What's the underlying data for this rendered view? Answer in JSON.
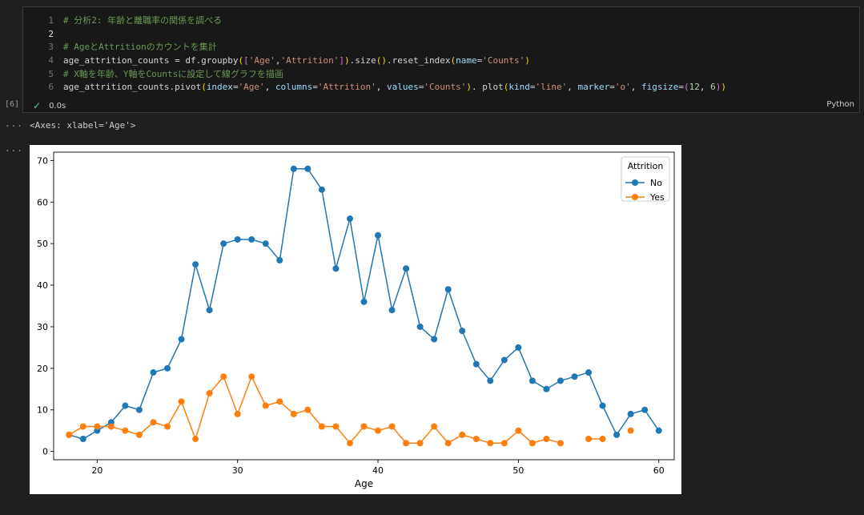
{
  "cell": {
    "execution_count": "[6]",
    "lines": [
      {
        "n": "1",
        "tokens": [
          {
            "t": "# 分析2: 年齢と離職率の関係を調べる",
            "c": "comment"
          }
        ]
      },
      {
        "n": "2",
        "tokens": []
      },
      {
        "n": "3",
        "tokens": [
          {
            "t": "# AgeとAttritionのカウントを集計",
            "c": "comment"
          }
        ]
      },
      {
        "n": "4",
        "tokens": [
          {
            "t": "age_attrition_counts = df.groupby",
            "c": ""
          },
          {
            "t": "(",
            "c": "paren1"
          },
          {
            "t": "[",
            "c": "paren2"
          },
          {
            "t": "'Age'",
            "c": "str"
          },
          {
            "t": ",",
            "c": ""
          },
          {
            "t": "'Attrition'",
            "c": "str"
          },
          {
            "t": "]",
            "c": "paren2"
          },
          {
            "t": ")",
            "c": "paren1"
          },
          {
            "t": ".size",
            "c": ""
          },
          {
            "t": "()",
            "c": "paren1"
          },
          {
            "t": ".reset_index",
            "c": ""
          },
          {
            "t": "(",
            "c": "paren1"
          },
          {
            "t": "name",
            "c": "param"
          },
          {
            "t": "=",
            "c": ""
          },
          {
            "t": "'Counts'",
            "c": "str"
          },
          {
            "t": ")",
            "c": "paren1"
          }
        ]
      },
      {
        "n": "5",
        "tokens": [
          {
            "t": "# X軸を年齢、Y軸をCountsに設定して線グラフを描画",
            "c": "comment"
          }
        ]
      },
      {
        "n": "6",
        "tokens": [
          {
            "t": "age_attrition_counts.pivot",
            "c": ""
          },
          {
            "t": "(",
            "c": "paren1"
          },
          {
            "t": "index",
            "c": "param"
          },
          {
            "t": "=",
            "c": ""
          },
          {
            "t": "'Age'",
            "c": "str"
          },
          {
            "t": ", ",
            "c": ""
          },
          {
            "t": "columns",
            "c": "param"
          },
          {
            "t": "=",
            "c": ""
          },
          {
            "t": "'Attrition'",
            "c": "str"
          },
          {
            "t": ", ",
            "c": ""
          },
          {
            "t": "values",
            "c": "param"
          },
          {
            "t": "=",
            "c": ""
          },
          {
            "t": "'Counts'",
            "c": "str"
          },
          {
            "t": ")",
            "c": "paren1"
          },
          {
            "t": ". plot",
            "c": ""
          },
          {
            "t": "(",
            "c": "paren1"
          },
          {
            "t": "kind",
            "c": "param"
          },
          {
            "t": "=",
            "c": ""
          },
          {
            "t": "'line'",
            "c": "str"
          },
          {
            "t": ", ",
            "c": ""
          },
          {
            "t": "marker",
            "c": "param"
          },
          {
            "t": "=",
            "c": ""
          },
          {
            "t": "'o'",
            "c": "str"
          },
          {
            "t": ", ",
            "c": ""
          },
          {
            "t": "figsize",
            "c": "param"
          },
          {
            "t": "=",
            "c": ""
          },
          {
            "t": "(",
            "c": "paren2"
          },
          {
            "t": "12",
            "c": "num"
          },
          {
            "t": ", ",
            "c": ""
          },
          {
            "t": "6",
            "c": "num"
          },
          {
            "t": ")",
            "c": "paren2"
          },
          {
            "t": ")",
            "c": "paren1"
          }
        ]
      }
    ],
    "status_time": "0.0s",
    "language": "Python"
  },
  "output": {
    "more_icon": "...",
    "text": "<Axes: xlabel='Age'>"
  },
  "chart_data": {
    "type": "line",
    "xlabel": "Age",
    "ylabel": "",
    "xlim": [
      16.9,
      61.1
    ],
    "ylim": [
      -2,
      72
    ],
    "xticks": [
      20,
      30,
      40,
      50,
      60
    ],
    "yticks": [
      0,
      10,
      20,
      30,
      40,
      50,
      60,
      70
    ],
    "legend": {
      "title": "Attrition",
      "placement": "top-right"
    },
    "grid": false,
    "x": [
      18,
      19,
      20,
      21,
      22,
      23,
      24,
      25,
      26,
      27,
      28,
      29,
      30,
      31,
      32,
      33,
      34,
      35,
      36,
      37,
      38,
      39,
      40,
      41,
      42,
      43,
      44,
      45,
      46,
      47,
      48,
      49,
      50,
      51,
      52,
      53,
      54,
      55,
      56,
      57,
      58,
      59,
      60
    ],
    "series": [
      {
        "name": "No",
        "color": "#1f77b4",
        "values": [
          4,
          3,
          5,
          7,
          11,
          10,
          19,
          20,
          27,
          45,
          34,
          50,
          51,
          51,
          50,
          46,
          68,
          68,
          63,
          44,
          56,
          36,
          52,
          34,
          44,
          30,
          27,
          39,
          29,
          21,
          17,
          22,
          25,
          17,
          15,
          17,
          18,
          19,
          11,
          4,
          9,
          10,
          5
        ]
      },
      {
        "name": "Yes",
        "color": "#ff7f0e",
        "values": [
          4,
          6,
          6,
          6,
          5,
          4,
          7,
          6,
          12,
          3,
          14,
          18,
          9,
          18,
          11,
          12,
          9,
          10,
          6,
          6,
          2,
          6,
          5,
          6,
          2,
          2,
          6,
          2,
          4,
          3,
          2,
          2,
          5,
          2,
          3,
          2,
          null,
          3,
          3,
          null,
          5,
          null,
          null
        ]
      }
    ]
  }
}
